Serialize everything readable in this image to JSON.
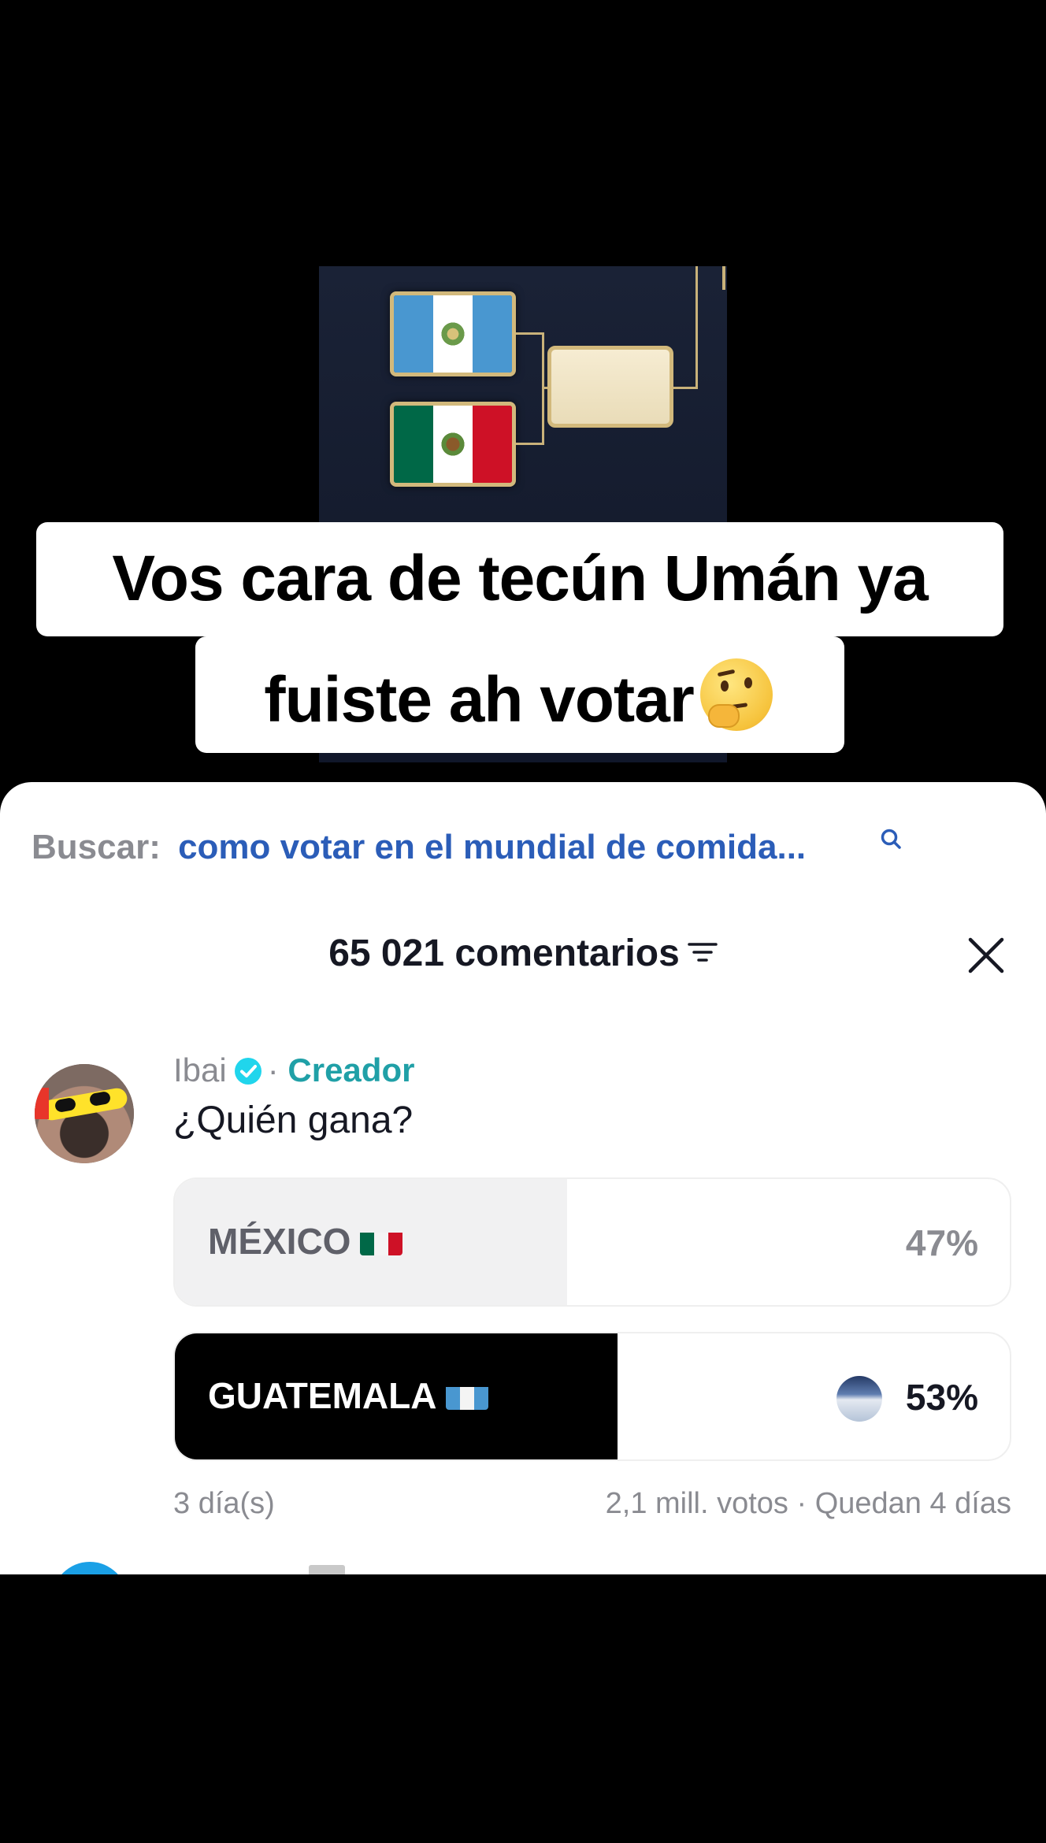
{
  "video": {
    "bracket": {
      "teams": [
        {
          "name": "Guatemala",
          "flag_colors": [
            "#4997d0",
            "#ffffff",
            "#4997d0"
          ]
        },
        {
          "name": "México",
          "flag_colors": [
            "#006847",
            "#ffffff",
            "#ce1126"
          ]
        }
      ],
      "accent": "#d2b97c"
    },
    "caption_line1": "Vos cara de tecún Umán ya",
    "caption_line2": "fuiste ah votar",
    "caption_emoji": "thinking-face-emoji"
  },
  "comments_sheet": {
    "search": {
      "label": "Buscar:",
      "query": "como votar en el mundial de comida...",
      "icon": "search-icon"
    },
    "header": {
      "count_label": "65 021 comentarios",
      "sort_icon": "sort-icon",
      "close_icon": "close-icon"
    },
    "comment": {
      "username": "Ibai",
      "verified_icon": "verified-badge-icon",
      "separator": "·",
      "role": "Creador",
      "text": "¿Quién gana?",
      "poll": {
        "options": [
          {
            "label": "MÉXICO",
            "flag": "mexico-flag-icon",
            "percent_label": "47%",
            "percent": 47,
            "selected": false
          },
          {
            "label": "GUATEMALA",
            "flag": "guatemala-flag-icon",
            "percent_label": "53%",
            "percent": 53,
            "selected": true
          }
        ],
        "time_ago": "3 día(s)",
        "stats": "2,1 mill. votos · Quedan 4 días"
      }
    }
  },
  "colors": {
    "sheet_bg": "#ffffff",
    "search_query": "#2b5db8",
    "creator": "#20a0a7",
    "muted": "#8a8b91",
    "selected_fill": "#000000",
    "unselected_fill": "#f1f1f2"
  }
}
